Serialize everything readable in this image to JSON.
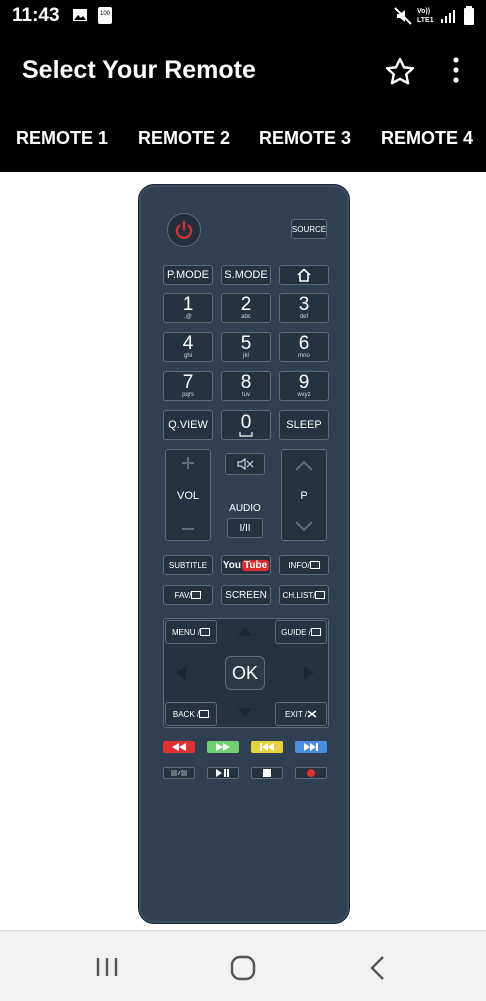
{
  "status_bar": {
    "time": "11:43",
    "battery_label": "100",
    "network_label": "Vo)) LTE1"
  },
  "app_bar": {
    "title": "Select Your Remote"
  },
  "tabs": [
    {
      "label": "REMOTE 1"
    },
    {
      "label": "REMOTE 2"
    },
    {
      "label": "REMOTE 3"
    },
    {
      "label": "REMOTE 4"
    }
  ],
  "remote": {
    "source": "SOURCE",
    "pmode": "P.MODE",
    "smode": "S.MODE",
    "numbers": [
      {
        "digit": "1",
        "letters": ".@"
      },
      {
        "digit": "2",
        "letters": "abc"
      },
      {
        "digit": "3",
        "letters": "def"
      },
      {
        "digit": "4",
        "letters": "ghi"
      },
      {
        "digit": "5",
        "letters": "jkl"
      },
      {
        "digit": "6",
        "letters": "mno"
      },
      {
        "digit": "7",
        "letters": "pqrs"
      },
      {
        "digit": "8",
        "letters": "tuv"
      },
      {
        "digit": "9",
        "letters": "wxyz"
      }
    ],
    "qview": "Q.VIEW",
    "zero": "0",
    "sleep": "SLEEP",
    "vol": "VOL",
    "audio": "AUDIO",
    "audio_btn": "I/II",
    "program": "P",
    "subtitle": "SUBTITLE",
    "youtube_you": "You",
    "youtube_tube": "Tube",
    "info": "INFO/",
    "fav": "FAV/",
    "screen": "SCREEN",
    "chlist": "CH.LIST/",
    "menu": "MENU /",
    "guide": "GUIDE /",
    "ok": "OK",
    "back": "BACK /",
    "exit": "EXIT /",
    "colors": {
      "red": "#e03030",
      "green": "#6fd06f",
      "yellow": "#e6d23a",
      "blue": "#4a8ee0"
    }
  }
}
